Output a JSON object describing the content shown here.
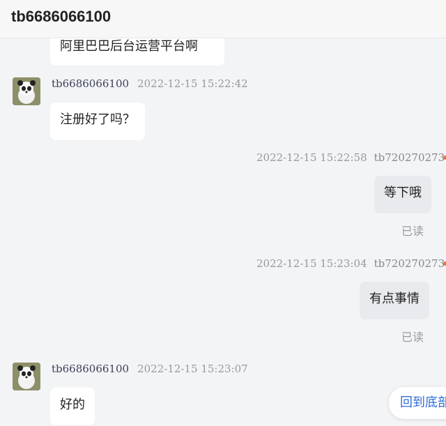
{
  "header": {
    "title": "tb6686066100"
  },
  "messages": [
    {
      "text": "阿里巴巴后台运营平台啊"
    },
    {
      "sender": "tb6686066100",
      "time": "2022-12-15 15:22:42",
      "text": "注册好了吗？"
    },
    {
      "sender": "tb720270273",
      "time": "2022-12-15 15:22:58",
      "text": "等下哦",
      "status": "已读"
    },
    {
      "sender": "tb720270273",
      "time": "2022-12-15 15:23:04",
      "text": "有点事情",
      "status": "已读"
    },
    {
      "sender": "tb6686066100",
      "time": "2022-12-15 15:23:07",
      "text": "好的"
    }
  ],
  "back_to_bottom": {
    "label": "回到底部"
  },
  "colors": {
    "accent_link": "#2f6bd8",
    "self_bubble": "#e9eaee",
    "other_bubble": "#ffffff",
    "indicator": "#e8743a"
  }
}
